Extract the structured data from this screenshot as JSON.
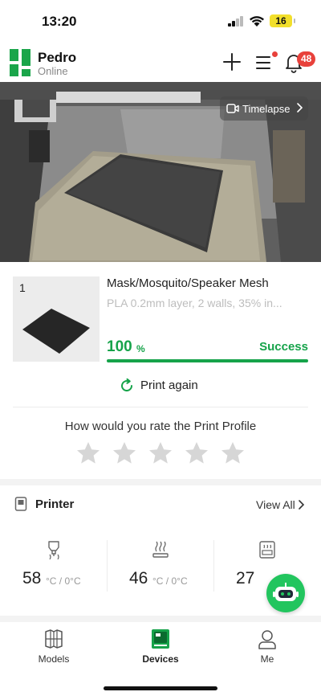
{
  "status_bar": {
    "time": "13:20",
    "battery": "16"
  },
  "header": {
    "printer_name": "Pedro",
    "printer_status": "Online",
    "notification_count": "48"
  },
  "camera": {
    "timelapse_label": "Timelapse"
  },
  "job": {
    "plate_number": "1",
    "title": "Mask/Mosquito/Speaker Mesh",
    "details": "PLA 0.2mm layer, 2 walls, 35% in...",
    "progress_value": "100",
    "progress_unit": "%",
    "progress_fraction": 1.0,
    "state": "Success",
    "print_again_label": "Print again",
    "rating_prompt": "How would you rate the Print Profile",
    "rating": 0,
    "rating_max": 5
  },
  "printer_section": {
    "title": "Printer",
    "view_all_label": "View All",
    "temps": [
      {
        "value": "58",
        "unit": "°C / 0°C",
        "icon": "nozzle-temp-icon"
      },
      {
        "value": "46",
        "unit": "°C / 0°C",
        "icon": "bed-temp-icon"
      },
      {
        "value": "27",
        "unit": "",
        "icon": "chamber-temp-icon"
      }
    ]
  },
  "tabs": [
    {
      "label": "Models",
      "icon": "models-icon"
    },
    {
      "label": "Devices",
      "icon": "devices-icon",
      "active": true
    },
    {
      "label": "Me",
      "icon": "profile-icon"
    }
  ],
  "colors": {
    "accent": "#16a34a",
    "badge": "#e8413b",
    "assistant": "#22c55e"
  }
}
